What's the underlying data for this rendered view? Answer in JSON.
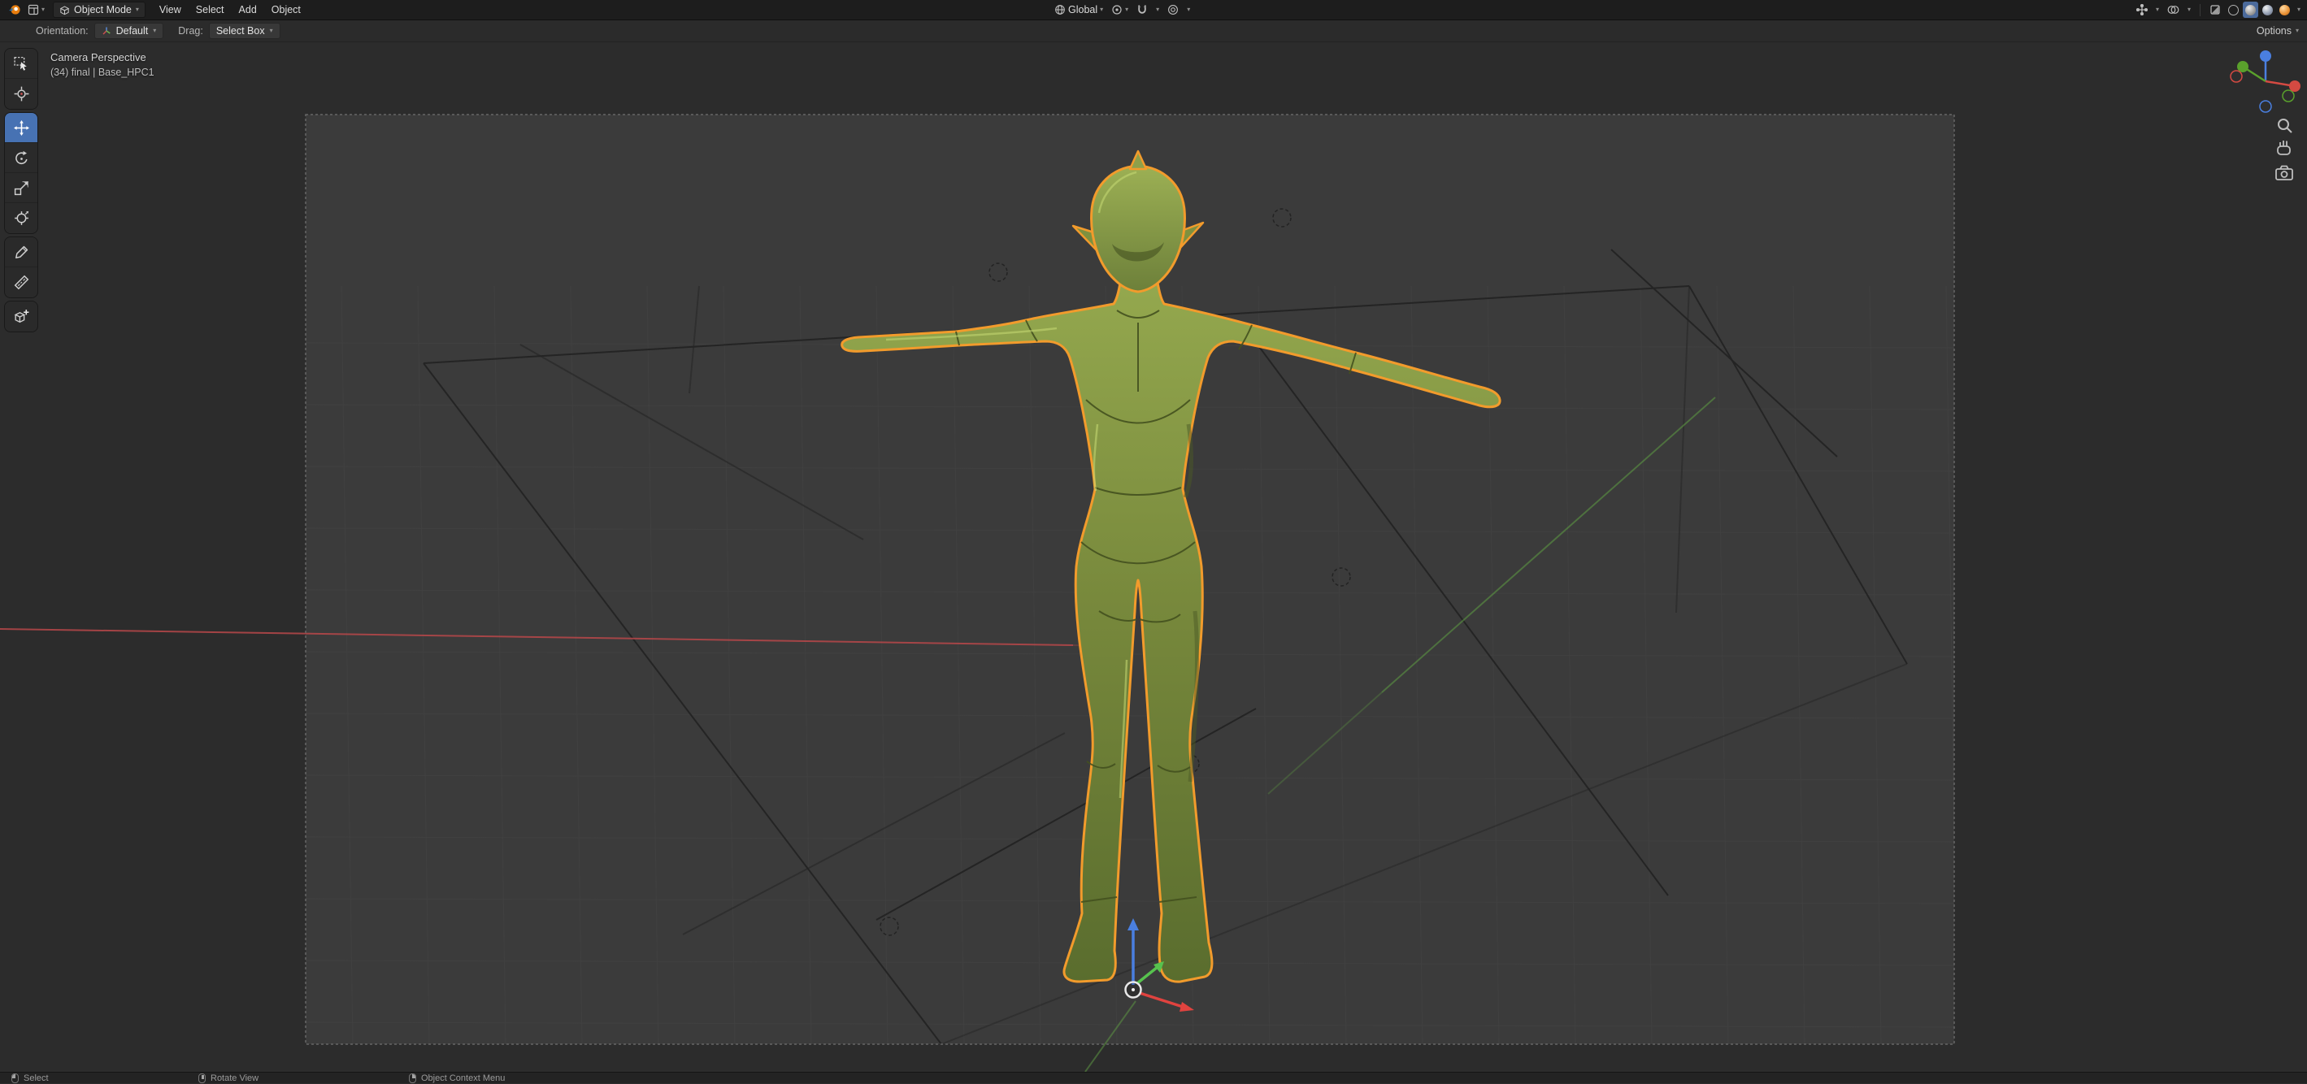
{
  "app_title": "Blender",
  "topbar": {
    "mode": "Object Mode",
    "menus": [
      "View",
      "Select",
      "Add",
      "Object"
    ],
    "orientation": "Global",
    "shading_modes": [
      "wireframe",
      "solid",
      "material-preview",
      "rendered"
    ],
    "active_shading": "solid"
  },
  "tool_settings": {
    "orientation_label": "Orientation:",
    "orientation_value": "Default",
    "drag_label": "Drag:",
    "drag_value": "Select Box",
    "options_label": "Options"
  },
  "viewport": {
    "view_label": "Camera Perspective",
    "scene_label": "(34) final | Base_HPC1",
    "tools": [
      "select-box",
      "cursor",
      "move",
      "rotate",
      "scale",
      "transform",
      "annotate",
      "measure",
      "add-cube"
    ],
    "active_tool": "move"
  },
  "status_bar": {
    "left": "Select",
    "middle": "Rotate View",
    "right": "Object Context Menu"
  },
  "icons": {
    "blender-logo": "orange-swirl-disc",
    "editor-type": "grid-squares",
    "mode-cube": "cube",
    "orientation": "globe",
    "pivot": "dot-in-circle",
    "snap": "magnet-u-shape",
    "proportional": "concentric-circles",
    "gizmos": "cross-arrows",
    "overlays": "overlapping-circles",
    "xray": "half-filled-square",
    "zoom": "magnifier",
    "pan": "hand",
    "camera-view": "camera"
  },
  "colors": {
    "accent": "#4772b3",
    "selection_outline": "#f09c2d",
    "model_green": "#78893c",
    "axis_x": "#c4484a",
    "axis_y": "#5f9e43",
    "axis_z": "#4a7fe0",
    "camera_inner": "#3b3b3b",
    "outer_background": "#2c2c2c"
  }
}
